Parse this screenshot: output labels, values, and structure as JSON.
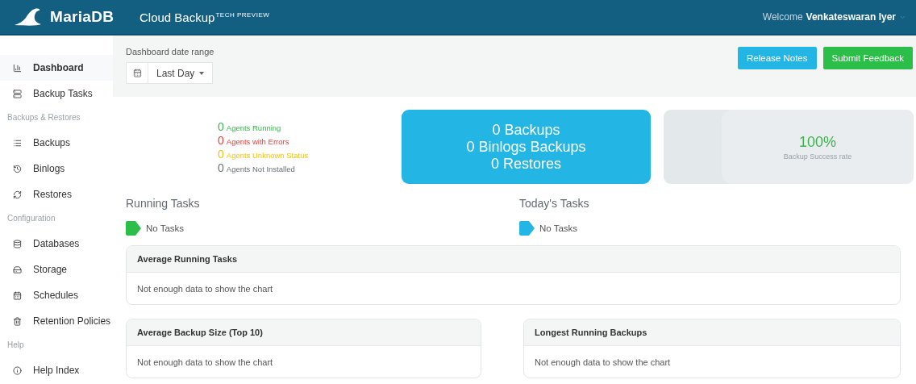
{
  "header": {
    "brand": "MariaDB",
    "app_title": "Cloud Backup",
    "app_badge": "TECH PREVIEW",
    "welcome": "Welcome",
    "user": "Venkateswaran Iyer"
  },
  "sidebar": {
    "sections": [
      {
        "items": [
          {
            "label": "Dashboard",
            "selected": true
          },
          {
            "label": "Backup Tasks",
            "selected": false
          }
        ]
      },
      {
        "title": "Backups & Restores",
        "items": [
          {
            "label": "Backups",
            "selected": false
          },
          {
            "label": "Binlogs",
            "selected": false
          },
          {
            "label": "Restores",
            "selected": false
          }
        ]
      },
      {
        "title": "Configuration",
        "items": [
          {
            "label": "Databases",
            "selected": false
          },
          {
            "label": "Storage",
            "selected": false
          },
          {
            "label": "Schedules",
            "selected": false
          },
          {
            "label": "Retention Policies",
            "selected": false
          }
        ]
      },
      {
        "title": "Help",
        "items": [
          {
            "label": "Help Index",
            "selected": false
          }
        ]
      }
    ]
  },
  "toolbar": {
    "date_range_label": "Dashboard date range",
    "date_range_value": "Last Day",
    "buttons": [
      {
        "label": "Release Notes",
        "kind": "info"
      },
      {
        "label": "Submit Feedback",
        "kind": "success"
      }
    ]
  },
  "agents": [
    {
      "count": "0",
      "label": "Agents Running",
      "color": "#3cb44b"
    },
    {
      "count": "0",
      "label": "Agents with Errors",
      "color": "#e8403a"
    },
    {
      "count": "0",
      "label": "Agents Unknown Status",
      "color": "#f2c318"
    },
    {
      "count": "0",
      "label": "Agents Not Installed",
      "color": "#6b7076"
    }
  ],
  "summary": [
    "0 Backups",
    "0 Binlogs Backups",
    "0 Restores"
  ],
  "success": {
    "value": "100%",
    "label": "Backup Success rate"
  },
  "task_lists": [
    {
      "title": "Running Tasks",
      "tag": "No Tasks",
      "color": "#2bbf4a"
    },
    {
      "title": "Today's Tasks",
      "tag": "No Tasks",
      "color": "#23b5e3"
    }
  ],
  "panels": [
    {
      "title": "Average Running Tasks",
      "message": "Not enough data to show the chart"
    },
    {
      "title": "Average Backup Size (Top 10)",
      "message": "Not enough data to show the chart"
    },
    {
      "title": "Longest Running Backups",
      "message": "Not enough data to show the chart"
    }
  ]
}
